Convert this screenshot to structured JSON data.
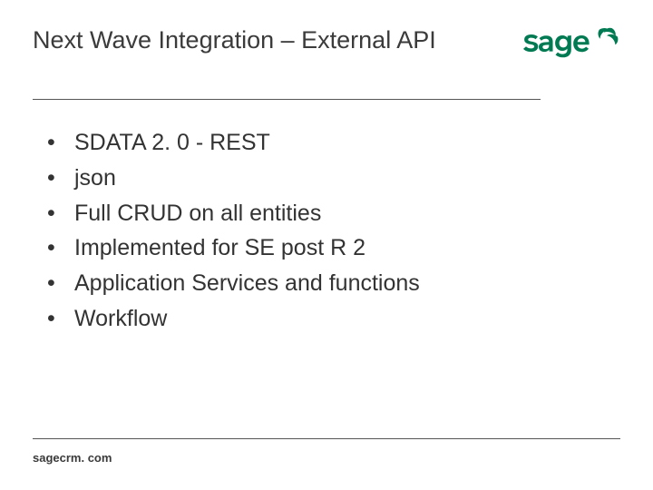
{
  "title": "Next Wave Integration – External API",
  "logo": {
    "name": "Sage",
    "color": "#007a52"
  },
  "bullets": [
    "SDATA 2. 0 - REST",
    "json",
    "Full CRUD on all entities",
    "Implemented for SE post R 2",
    "Application Services and functions",
    "Workflow"
  ],
  "footer": "sagecrm. com"
}
